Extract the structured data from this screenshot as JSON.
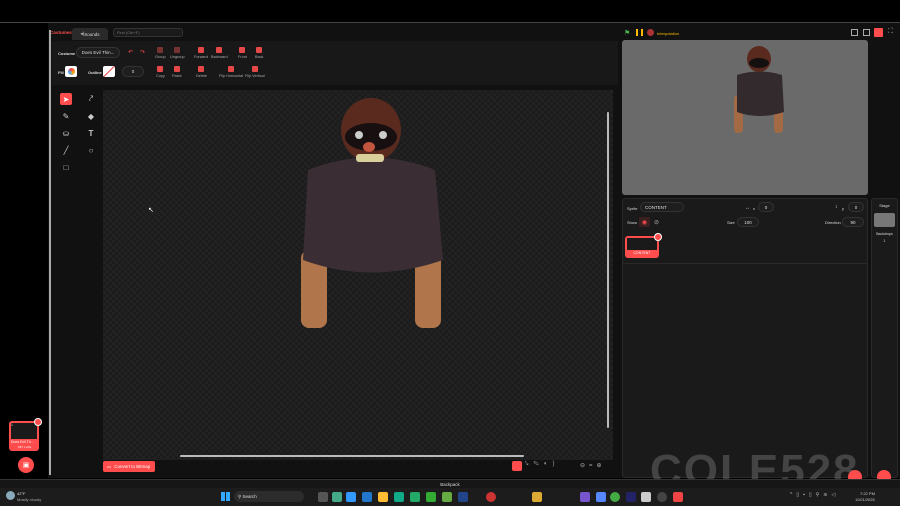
{
  "tabs": {
    "costumes": "Costumes",
    "sounds": "Sounds",
    "find_placeholder": "Find (Ctrl+F)"
  },
  "toolbar": {
    "costume_label": "Costume",
    "costume_name": "Does Evil Thin...",
    "group": "Group",
    "ungroup": "Ungroup",
    "forward": "Forward",
    "backward": "Backward",
    "front": "Front",
    "back": "Back",
    "fill_label": "Fill",
    "outline_label": "Outline",
    "outline_width": "0",
    "copy": "Copy",
    "paste": "Paste",
    "delete": "Delete",
    "flip_h": "Flip Horizontal",
    "flip_v": "Flip Vertical"
  },
  "canvas": {
    "convert_button": "Convert to Bitmap"
  },
  "costume_list": {
    "items": [
      {
        "number": "1",
        "name": "Does Evil Th...",
        "size": "187 x 244"
      }
    ]
  },
  "stage_header": {
    "interpolation": "Interpolation"
  },
  "sprite_info": {
    "sprite_label": "Sprite",
    "sprite_name": "CONTENT",
    "x_label": "x",
    "x_value": "0",
    "y_label": "y",
    "y_value": "0",
    "show_label": "Show",
    "size_label": "Size",
    "size_value": "100",
    "direction_label": "Direction",
    "direction_value": "90"
  },
  "sprites": [
    {
      "name": "CONTENT",
      "selected": true
    }
  ],
  "stage_pane": {
    "title": "Stage",
    "backdrops_label": "Backdrops",
    "backdrops_count": "1"
  },
  "backpack": "Backpack",
  "watermark": "COLE528",
  "taskbar": {
    "weather_temp": "42°F",
    "weather_text": "Mostly cloudy",
    "search": "Search",
    "time": "7:22 PM",
    "date": "11/01/2025"
  },
  "colors": {
    "accent": "#ff4c4c",
    "background": "#111111",
    "panel": "#1e1e1e"
  }
}
